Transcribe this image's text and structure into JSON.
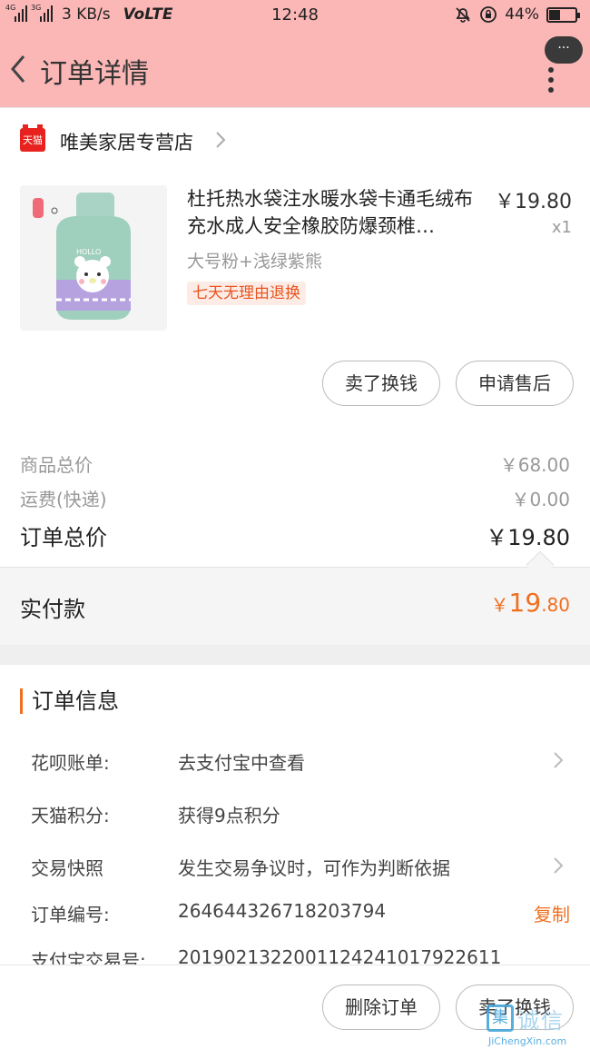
{
  "status_bar": {
    "net_4g": "4G",
    "net_3g": "3G",
    "speed": "3 KB/s",
    "volte": "VoLTE",
    "time": "12:48",
    "battery": "44%",
    "battery_level": 0.44
  },
  "nav": {
    "title": "订单详情",
    "more_bubble": "···"
  },
  "store": {
    "logo_text": "天猫",
    "name": "唯美家居专营店"
  },
  "product": {
    "title": "杜托热水袋注水暖水袋卡通毛绒布充水成人安全橡胶防爆颈椎…",
    "price": "￥19.80",
    "qty": "x1",
    "sku": "大号粉+浅绿紫熊",
    "badge": "七天无理由退换",
    "image_text": "HOLLO"
  },
  "product_actions": {
    "sell": "卖了换钱",
    "after_sale": "申请售后"
  },
  "summary": {
    "goods_label": "商品总价",
    "goods_value": "￥68.00",
    "shipping_label": "运费(快递)",
    "shipping_value": "￥0.00",
    "total_label": "订单总价",
    "total_value": "￥19.80"
  },
  "paid": {
    "label": "实付款",
    "symbol": "￥",
    "integer": "19",
    "decimal": ".80"
  },
  "order_info": {
    "heading": "订单信息",
    "huabei_label": "花呗账单:",
    "huabei_value": "去支付宝中查看",
    "points_label": "天猫积分:",
    "points_value": "获得9点积分",
    "snapshot_label": "交易快照",
    "snapshot_value": "发生交易争议时，可作为判断依据",
    "order_no_label": "订单编号:",
    "order_no_value": "264644326718203794",
    "copy": "复制",
    "alipay_label": "支付宝交易号:",
    "alipay_value": "2019021322001124241017922611"
  },
  "bottom_actions": {
    "delete": "删除订单",
    "sell": "卖了换钱"
  },
  "watermark": {
    "mark": "集",
    "text": "诚信",
    "url": "JiChengXin.com"
  },
  "colors": {
    "header": "#fbb6b6",
    "accent": "#f06f1f",
    "tmall": "#e8231f"
  }
}
